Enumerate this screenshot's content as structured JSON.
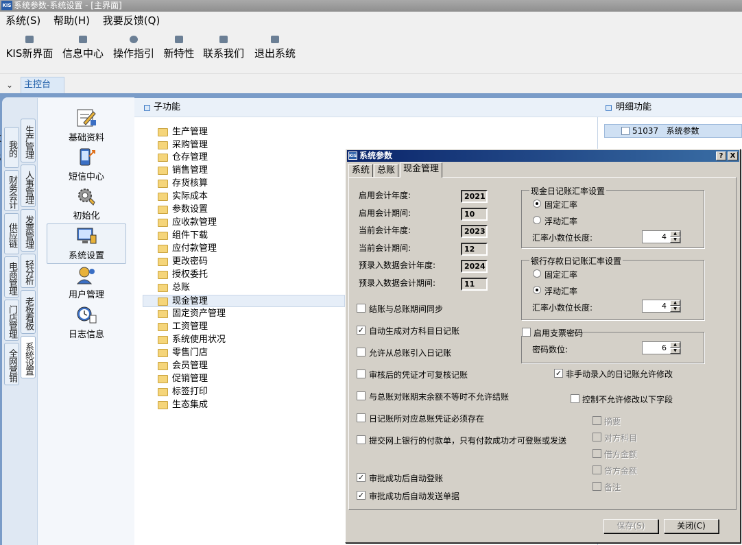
{
  "window": {
    "title": "系统参数-系统设置 - [主界面]",
    "logo": "KIS"
  },
  "menu": [
    "系统(S)",
    "帮助(H)",
    "我要反馈(Q)"
  ],
  "toolbar": [
    {
      "label": "KIS新界面",
      "icon": "layout-icon"
    },
    {
      "label": "信息中心",
      "icon": "mail-icon"
    },
    {
      "label": "操作指引",
      "icon": "compass-icon"
    },
    {
      "label": "新特性",
      "icon": "star-icon"
    },
    {
      "label": "联系我们",
      "icon": "chat-icon"
    },
    {
      "label": "退出系统",
      "icon": "exit-icon"
    }
  ],
  "tabstrip": {
    "active_tab": "主控台"
  },
  "side_tabs": [
    "我的KIS",
    "财务会计",
    "供应链",
    "电商管理",
    "门店管理",
    "全网营销",
    "生产管理",
    "人事管理",
    "发票管理",
    "轻分析",
    "老板看板",
    "系统设置"
  ],
  "modules": [
    "基础资料",
    "短信中心",
    "初始化",
    "系统设置",
    "用户管理",
    "日志信息"
  ],
  "sub_functions": {
    "header": "子功能",
    "items": [
      "生产管理",
      "采购管理",
      "仓存管理",
      "销售管理",
      "存货核算",
      "实际成本",
      "参数设置",
      "应收款管理",
      "组件下载",
      "应付款管理",
      "更改密码",
      "授权委托",
      "总账",
      "现金管理",
      "固定资产管理",
      "工资管理",
      "系统使用状况",
      "零售门店",
      "会员管理",
      "促销管理",
      "标签打印",
      "生态集成"
    ],
    "selected": "现金管理"
  },
  "detail": {
    "header": "明细功能",
    "item_code": "51037",
    "item_name": "系统参数"
  },
  "dialog": {
    "title": "系统参数",
    "help_btn": "?",
    "close_btn": "X",
    "tabs": [
      "系统",
      "总账",
      "现金管理"
    ],
    "active_tab": "现金管理",
    "fields": [
      {
        "label": "启用会计年度:",
        "value": "2021"
      },
      {
        "label": "启用会计期间:",
        "value": "10"
      },
      {
        "label": "当前会计年度:",
        "value": "2023"
      },
      {
        "label": "当前会计期间:",
        "value": "12"
      },
      {
        "label": "预录入数据会计年度:",
        "value": "2024"
      },
      {
        "label": "预录入数据会计期间:",
        "value": "11"
      }
    ],
    "cash_rate_group": {
      "title": "现金日记账汇率设置",
      "fixed": "固定汇率",
      "float": "浮动汇率",
      "selected": "固定汇率",
      "decimals_label": "汇率小数位长度:",
      "decimals": "4"
    },
    "bank_rate_group": {
      "title": "银行存款日记账汇率设置",
      "fixed": "固定汇率",
      "float": "浮动汇率",
      "selected": "浮动汇率",
      "decimals_label": "汇率小数位长度:",
      "decimals": "4"
    },
    "check_pwd": {
      "label": "启用支票密码",
      "checked": false,
      "digits_label": "密码数位:",
      "digits": "6"
    },
    "left_checks": [
      {
        "label": "结账与总账期间同步",
        "checked": false
      },
      {
        "label": "自动生成对方科目日记账",
        "checked": true
      },
      {
        "label": "允许从总账引入日记账",
        "checked": false
      },
      {
        "label": "审核后的凭证才可复核记账",
        "checked": false
      },
      {
        "label": "与总账对账期末余额不等时不允许结账",
        "checked": false
      },
      {
        "label": "日记账所对应总账凭证必须存在",
        "checked": false
      },
      {
        "label": "提交网上银行的付款单，只有付款成功才可登账或发送",
        "checked": false
      },
      {
        "label": "审批成功后自动登账",
        "checked": true
      },
      {
        "label": "审批成功后自动发送单据",
        "checked": true
      }
    ],
    "non_manual": {
      "label": "非手动录入的日记账允许修改",
      "checked": true
    },
    "control_fields": {
      "label": "控制不允许修改以下字段",
      "checked": false
    },
    "disabled_fields": [
      "摘要",
      "对方科目",
      "借方金额",
      "贷方金额",
      "备注"
    ],
    "buttons": {
      "save": "保存(S)",
      "close": "关闭(C)"
    }
  }
}
